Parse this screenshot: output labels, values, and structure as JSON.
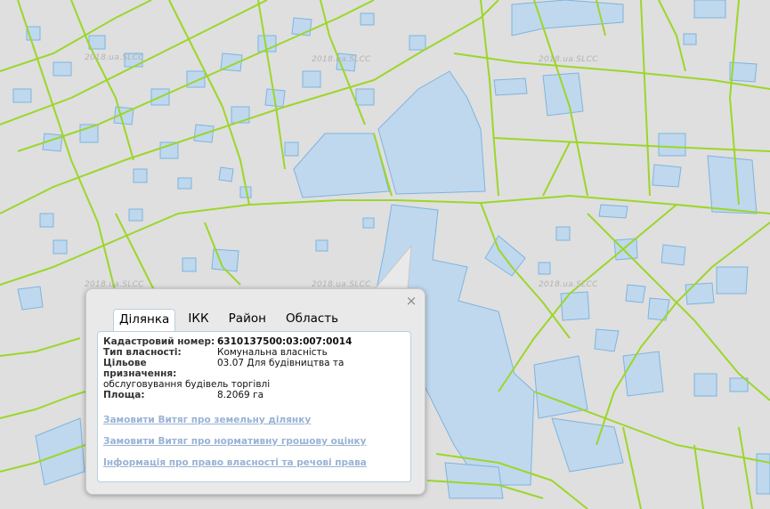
{
  "watermark": "2018.ua.SLCC",
  "colors": {
    "background": "#dfdfdf",
    "boundary": "#9cd62a",
    "parcel_fill": "#bfd8ee",
    "parcel_stroke": "#7eb4de",
    "link": "#99b2d4"
  },
  "popup": {
    "close_icon": "×",
    "tabs": [
      {
        "label": "Ділянка",
        "active": true
      },
      {
        "label": "ІКК",
        "active": false
      },
      {
        "label": "Район",
        "active": false
      },
      {
        "label": "Область",
        "active": false
      }
    ],
    "fields": {
      "cadastral_label": "Кадастровий номер:",
      "cadastral_value": "6310137500:03:007:0014",
      "ownership_label": "Тип власності:",
      "ownership_value": "Комунальна власність",
      "purpose_label": "Цільове призначення:",
      "purpose_value": "03.07 Для будівництва та",
      "purpose_value_2": "обслуговування будівель торгівлі",
      "area_label": "Площа:",
      "area_value": "8.2069 га"
    },
    "links": [
      "Замовити Витяг про земельну ділянку",
      "Замовити Витяг про нормативну грошову оцінку",
      "Інформація про право власності та речові права"
    ]
  }
}
